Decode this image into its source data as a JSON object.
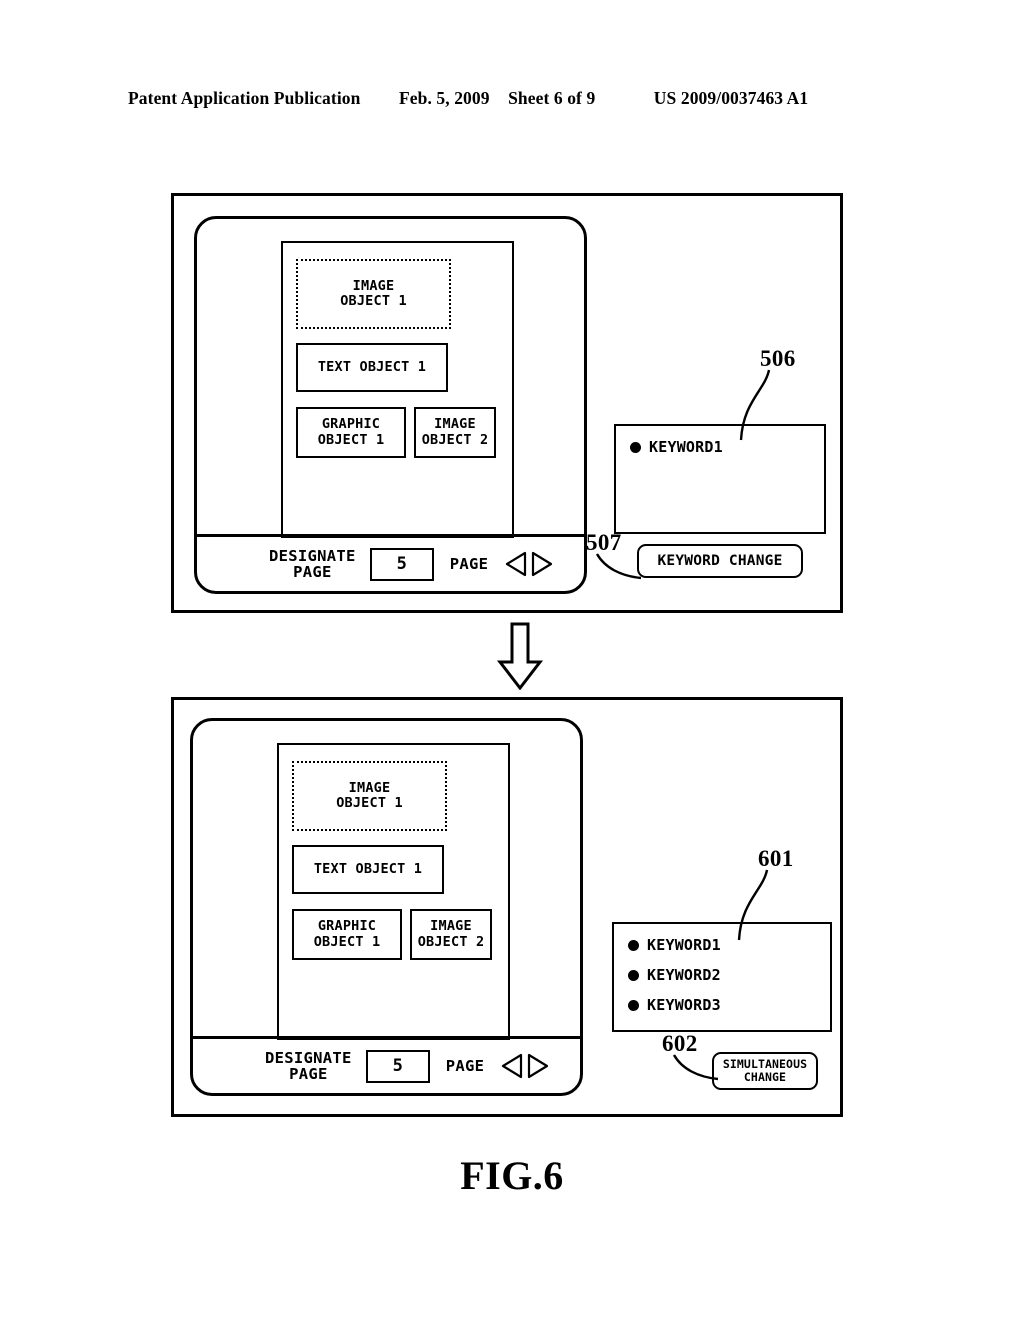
{
  "header": {
    "publication": "Patent Application Publication",
    "date": "Feb. 5, 2009",
    "sheet": "Sheet 6 of 9",
    "patent_number": "US 2009/0037463 A1"
  },
  "figure": {
    "caption": "FIG.6"
  },
  "transition": {
    "arrow_icon": "down-arrow-icon"
  },
  "panels": [
    {
      "id": "before",
      "preview_objects": [
        {
          "label": "IMAGE\nOBJECT 1",
          "style": "dashed",
          "name": "image-object-1"
        },
        {
          "label": "TEXT OBJECT 1",
          "style": "solid",
          "name": "text-object-1"
        },
        {
          "label": "GRAPHIC\nOBJECT 1",
          "style": "solid",
          "name": "graphic-object-1"
        },
        {
          "label": "IMAGE\nOBJECT 2",
          "style": "solid",
          "name": "image-object-2"
        }
      ],
      "toolbar": {
        "designate_label": "DESIGNATE\nPAGE",
        "page_value": "5",
        "page_label": "PAGE",
        "prev_icon": "left-triangle-icon",
        "next_icon": "right-triangle-icon"
      },
      "keyword_box": {
        "ref": "506",
        "keywords": [
          "KEYWORD1"
        ]
      },
      "button": {
        "ref": "507",
        "label": "KEYWORD CHANGE"
      }
    },
    {
      "id": "after",
      "preview_objects": [
        {
          "label": "IMAGE\nOBJECT 1",
          "style": "dashed",
          "name": "image-object-1"
        },
        {
          "label": "TEXT OBJECT 1",
          "style": "solid",
          "name": "text-object-1"
        },
        {
          "label": "GRAPHIC\nOBJECT 1",
          "style": "solid",
          "name": "graphic-object-1"
        },
        {
          "label": "IMAGE\nOBJECT 2",
          "style": "solid",
          "name": "image-object-2"
        }
      ],
      "toolbar": {
        "designate_label": "DESIGNATE\nPAGE",
        "page_value": "5",
        "page_label": "PAGE",
        "prev_icon": "left-triangle-icon",
        "next_icon": "right-triangle-icon"
      },
      "keyword_box": {
        "ref": "601",
        "keywords": [
          "KEYWORD1",
          "KEYWORD2",
          "KEYWORD3"
        ]
      },
      "button": {
        "ref": "602",
        "label": "SIMULTANEOUS\nCHANGE"
      }
    }
  ]
}
